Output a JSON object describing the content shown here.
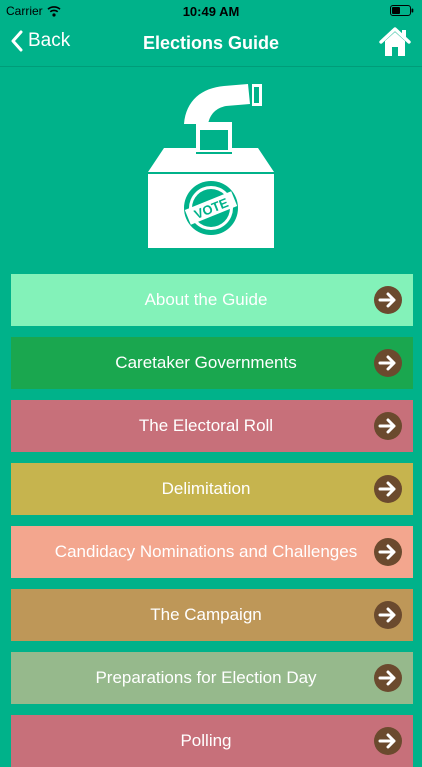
{
  "status_bar": {
    "carrier": "Carrier",
    "time": "10:49 AM"
  },
  "nav": {
    "back_label": "Back",
    "title": "Elections Guide"
  },
  "colors": {
    "background": "#00b28a",
    "arrow_circle": "#6b4a2e"
  },
  "icons": {
    "wifi": "wifi-icon",
    "battery": "battery-icon",
    "back": "chevron-left-icon",
    "home": "home-icon",
    "illustration": "ballot-box-vote-icon",
    "row_arrow": "arrow-right-circle-icon"
  },
  "menu": {
    "items": [
      {
        "label": "About the Guide",
        "color": "#83f2b9"
      },
      {
        "label": "Caretaker Governments",
        "color": "#1aa74f"
      },
      {
        "label": "The Electoral Roll",
        "color": "#c7707a"
      },
      {
        "label": "Delimitation",
        "color": "#c6b44e"
      },
      {
        "label": "Candidacy Nominations and Challenges",
        "color": "#f3a68e"
      },
      {
        "label": "The Campaign",
        "color": "#be9758"
      },
      {
        "label": "Preparations for Election Day",
        "color": "#96b98c"
      },
      {
        "label": "Polling",
        "color": "#c7707a"
      }
    ]
  }
}
